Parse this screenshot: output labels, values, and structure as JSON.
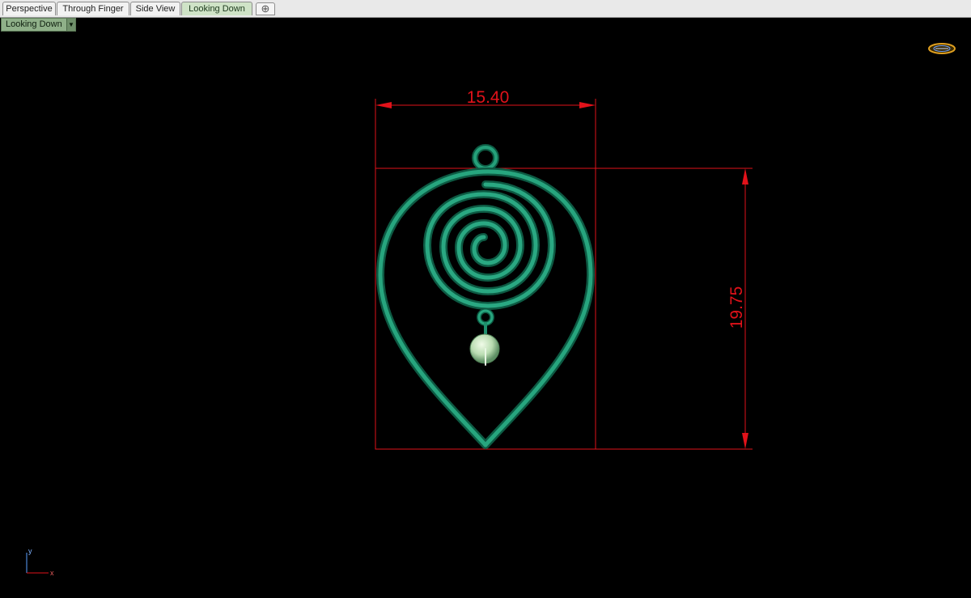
{
  "tabs": [
    {
      "label": "Perspective",
      "active": false
    },
    {
      "label": "Through Finger",
      "active": false
    },
    {
      "label": "Side View",
      "active": false
    },
    {
      "label": "Looking Down",
      "active": true
    }
  ],
  "add_tab_icon": "plus-icon",
  "viewport": {
    "title": "Looking Down",
    "dropdown_icon": "triangle-down-icon"
  },
  "dimensions": {
    "width_value": "15.40",
    "height_value": "19.75",
    "color": "#e1121a"
  },
  "model": {
    "color": "#1f8f6d",
    "bead_color": "#c9e6c4"
  },
  "axes": {
    "y_label": "y",
    "x_label": "x"
  },
  "gizmo_icon": "view-gizmo-icon"
}
